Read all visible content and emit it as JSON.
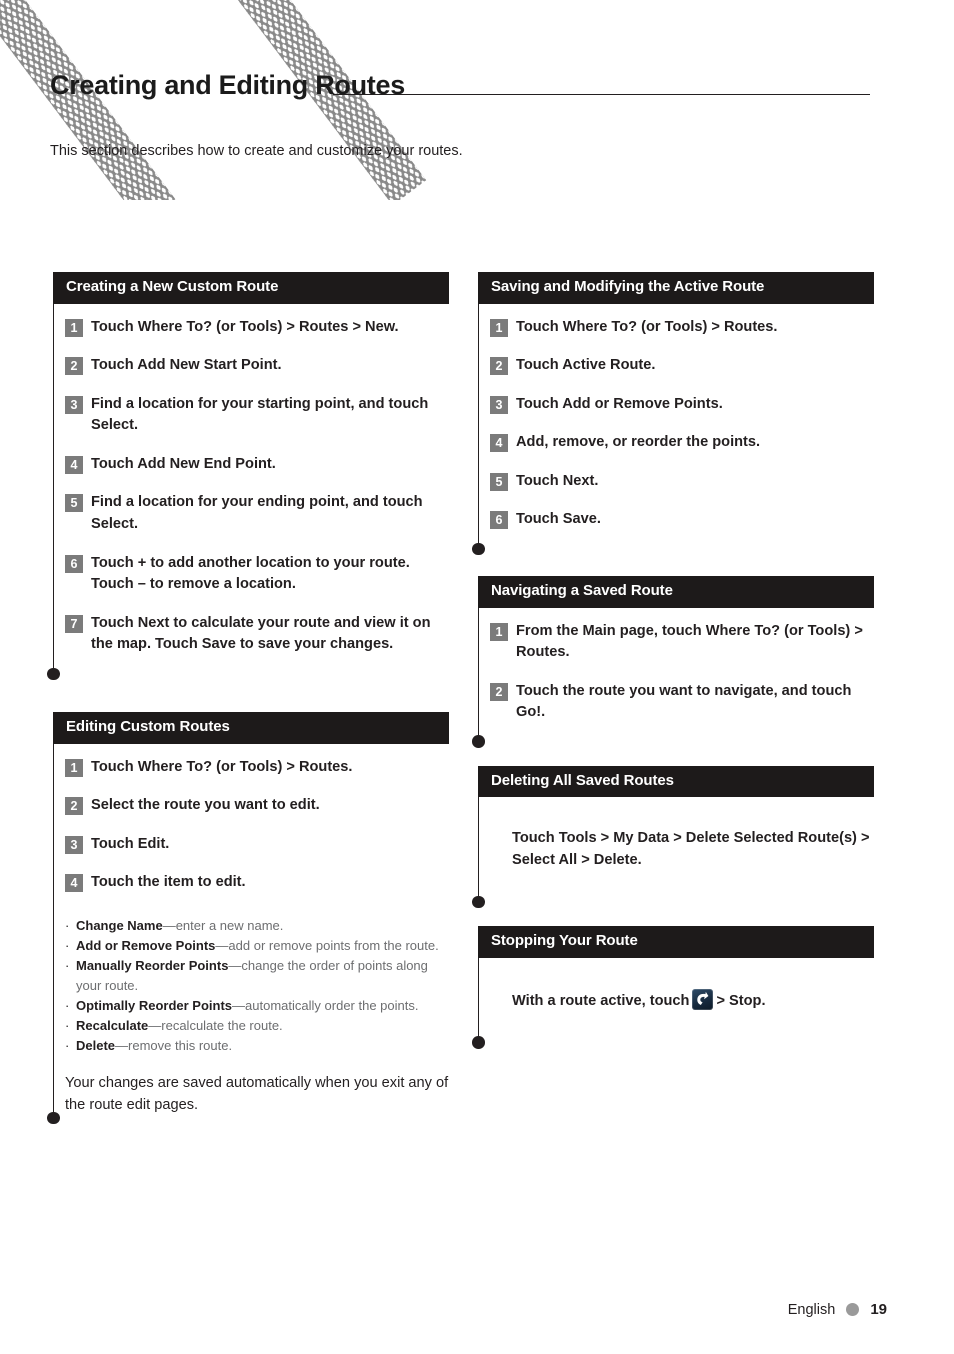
{
  "page": {
    "title": "Creating and Editing Routes",
    "intro": "This section describes how to create and customize your routes."
  },
  "left_column": {
    "sections": [
      {
        "heading": "Creating a New Custom Route",
        "steps": [
          "Touch Where To? (or Tools) > Routes > New.",
          "Touch Add New Start Point.",
          "Find a location for your starting point, and touch Select.",
          "Touch Add New End Point.",
          "Find a location for your ending point, and touch Select.",
          "Touch + to add another location to your route. Touch – to remove a location.",
          "Touch Next to calculate your route and view it on the map. Touch Save to save your changes."
        ],
        "step_numbers": [
          "1",
          "2",
          "3",
          "4",
          "5",
          "6",
          "7"
        ]
      },
      {
        "heading": "Editing Custom Routes",
        "steps": [
          "Touch Where To? (or Tools) > Routes.",
          "Select the route you want to edit.",
          "Touch Edit.",
          "Touch the item to edit."
        ],
        "step_numbers": [
          "1",
          "2",
          "3",
          "4"
        ],
        "bullets": [
          {
            "term": "Change Name",
            "desc": "—enter a new name."
          },
          {
            "term": "Add or Remove Points",
            "desc": "—add or remove points from the route."
          },
          {
            "term": "Manually Reorder Points",
            "desc": "—change the order of points along your route."
          },
          {
            "term": "Optimally Reorder Points",
            "desc": "—automatically order the points."
          },
          {
            "term": "Recalculate",
            "desc": "—recalculate the route."
          },
          {
            "term": "Delete",
            "desc": "—remove this route."
          }
        ],
        "closing": "Your changes are saved automatically when you exit any of the route edit pages."
      }
    ]
  },
  "right_column": {
    "sections": [
      {
        "heading": "Saving and Modifying the Active Route",
        "steps": [
          "Touch Where To? (or Tools) > Routes.",
          "Touch Active Route.",
          "Touch Add or Remove Points.",
          "Add, remove, or reorder the points.",
          "Touch Next.",
          "Touch Save."
        ],
        "step_numbers": [
          "1",
          "2",
          "3",
          "4",
          "5",
          "6"
        ]
      },
      {
        "heading": "Navigating a Saved Route",
        "steps": [
          "From the Main page, touch Where To? (or Tools) > Routes.",
          "Touch the route you want to navigate, and touch Go!."
        ],
        "step_numbers": [
          "1",
          "2"
        ]
      },
      {
        "heading": "Deleting All Saved Routes",
        "paragraph": "Touch Tools > My Data > Delete Selected Route(s) > Select All > Delete."
      },
      {
        "heading": "Stopping Your Route",
        "paragraph_before_icon": "With a route active, touch",
        "icon_name": "stop-route-icon",
        "paragraph_after_icon": "> Stop."
      }
    ]
  },
  "footer": {
    "language": "English",
    "page_number": "19"
  },
  "colors": {
    "section_header_bg": "#1d1a1a",
    "step_badge_bg": "#7b7b7b",
    "text": "#231f20",
    "muted_text": "#6d6e70",
    "footer_dot": "#9a9a9a",
    "icon_bg": "#16293d"
  }
}
